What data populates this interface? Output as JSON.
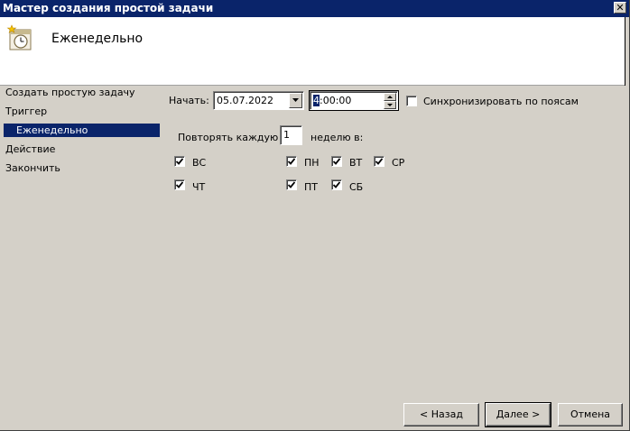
{
  "window": {
    "title": "Мастер создания простой задачи",
    "close_glyph": "✕"
  },
  "header": {
    "title": "Еженедельно",
    "icon": "calendar-clock-icon"
  },
  "nav": {
    "items": [
      {
        "label": "Создать простую задачу",
        "selected": false
      },
      {
        "label": "Триггер",
        "selected": false
      },
      {
        "label": "Еженедельно",
        "selected": true
      },
      {
        "label": "Действие",
        "selected": false
      },
      {
        "label": "Закончить",
        "selected": false
      }
    ]
  },
  "schedule": {
    "start_label": "Начать:",
    "start_date": "05.07.2022",
    "start_time_first": "4",
    "start_time_rest": ":00:00",
    "sync_label": "Синхронизировать по поясам",
    "sync_checked": false,
    "repeat_label": "Повторять каждую",
    "repeat_value": "1",
    "weeks_label": "неделю в:"
  },
  "days": [
    {
      "label": "ВС",
      "checked": true
    },
    {
      "label": "ПН",
      "checked": true
    },
    {
      "label": "ВТ",
      "checked": true
    },
    {
      "label": "СР",
      "checked": true
    },
    {
      "label": "ЧТ",
      "checked": true
    },
    {
      "label": "ПТ",
      "checked": true
    },
    {
      "label": "СБ",
      "checked": true
    }
  ],
  "buttons": {
    "back": "< Назад",
    "next": "Далее >",
    "cancel": "Отмена"
  },
  "colors": {
    "selection": "#0a246a",
    "face": "#d4d0c8"
  }
}
